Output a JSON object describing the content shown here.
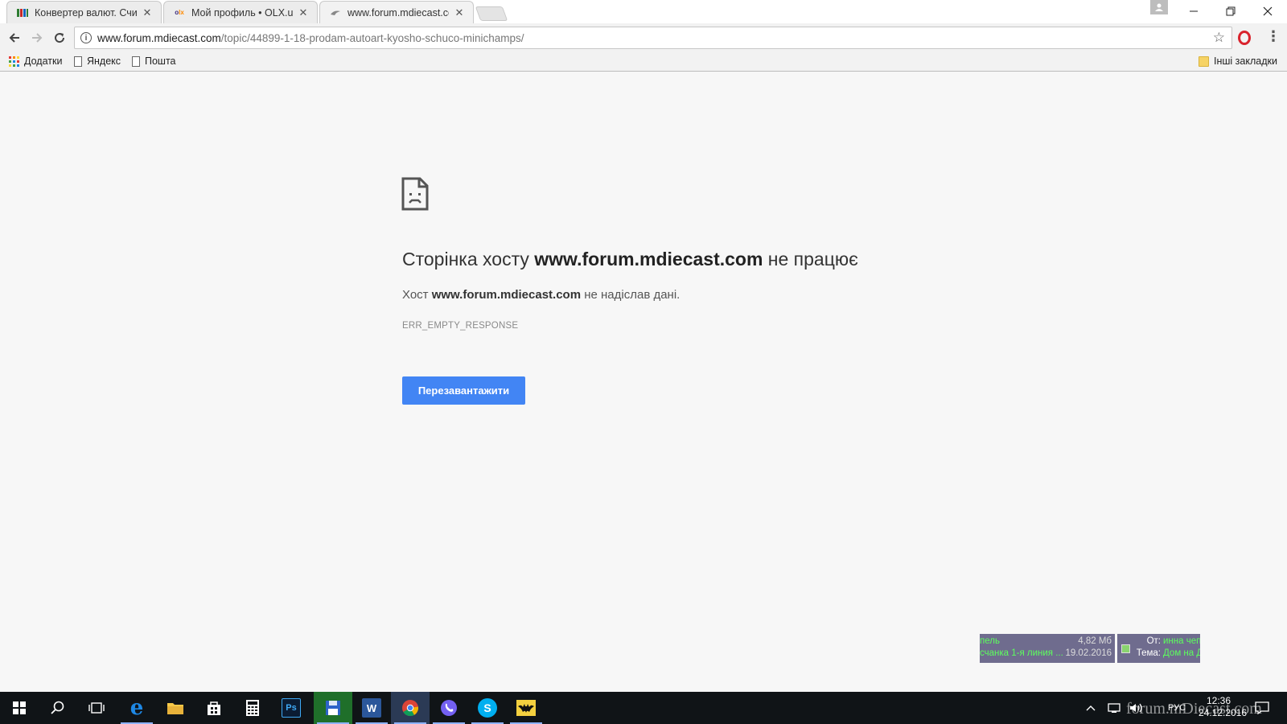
{
  "tabs": [
    {
      "title": "Конвертер валют. Счита",
      "favicon": "currency-favicon"
    },
    {
      "title": "Мой профиль • OLX.ua",
      "favicon": "olx-favicon"
    },
    {
      "title": "www.forum.mdiecast.com",
      "favicon": "mdiecast-favicon"
    }
  ],
  "address_bar": {
    "host": "www.forum.mdiecast.com",
    "path": "/topic/44899-1-18-prodam-autoart-kyosho-schuco-minichamps/"
  },
  "bookmarks": [
    {
      "label": "Додатки",
      "icon": "apps-icon"
    },
    {
      "label": "Яндекс",
      "icon": "page-icon"
    },
    {
      "label": "Пошта",
      "icon": "page-icon"
    }
  ],
  "other_bookmarks": "Інші закладки",
  "error_page": {
    "headline_pre": "Сторінка хосту ",
    "headline_host": "www.forum.mdiecast.com",
    "headline_post": " не працює",
    "sub_pre": "Хост ",
    "sub_host": "www.forum.mdiecast.com",
    "sub_post": " не надіслав дані.",
    "code": "ERR_EMPTY_RESPONSE",
    "reload_label": "Перезавантажити"
  },
  "download_widget": {
    "name1": "пель",
    "size": "4,82 Мб",
    "name2": "счанка 1-я линия ...",
    "date": "19.02.2016"
  },
  "mail_widget": {
    "from_label": "От:",
    "from_value": "инна чепель",
    "subject_label": "Тема:",
    "subject_value": "Дом на Д"
  },
  "taskbar": {
    "apps": [
      "start",
      "search",
      "task-view",
      "edge",
      "file-explorer",
      "store",
      "calculator",
      "photoshop",
      "save-app",
      "word",
      "chrome",
      "viber",
      "skype",
      "batman-app"
    ],
    "language": "РУС",
    "time": "12:36",
    "date": "24.12.2016"
  },
  "watermark": "forum.mDiecast.com",
  "colors": {
    "reload_button": "#4285f4",
    "widget_bg": "#6f6c8e",
    "widget_text": "#5dff5d"
  }
}
